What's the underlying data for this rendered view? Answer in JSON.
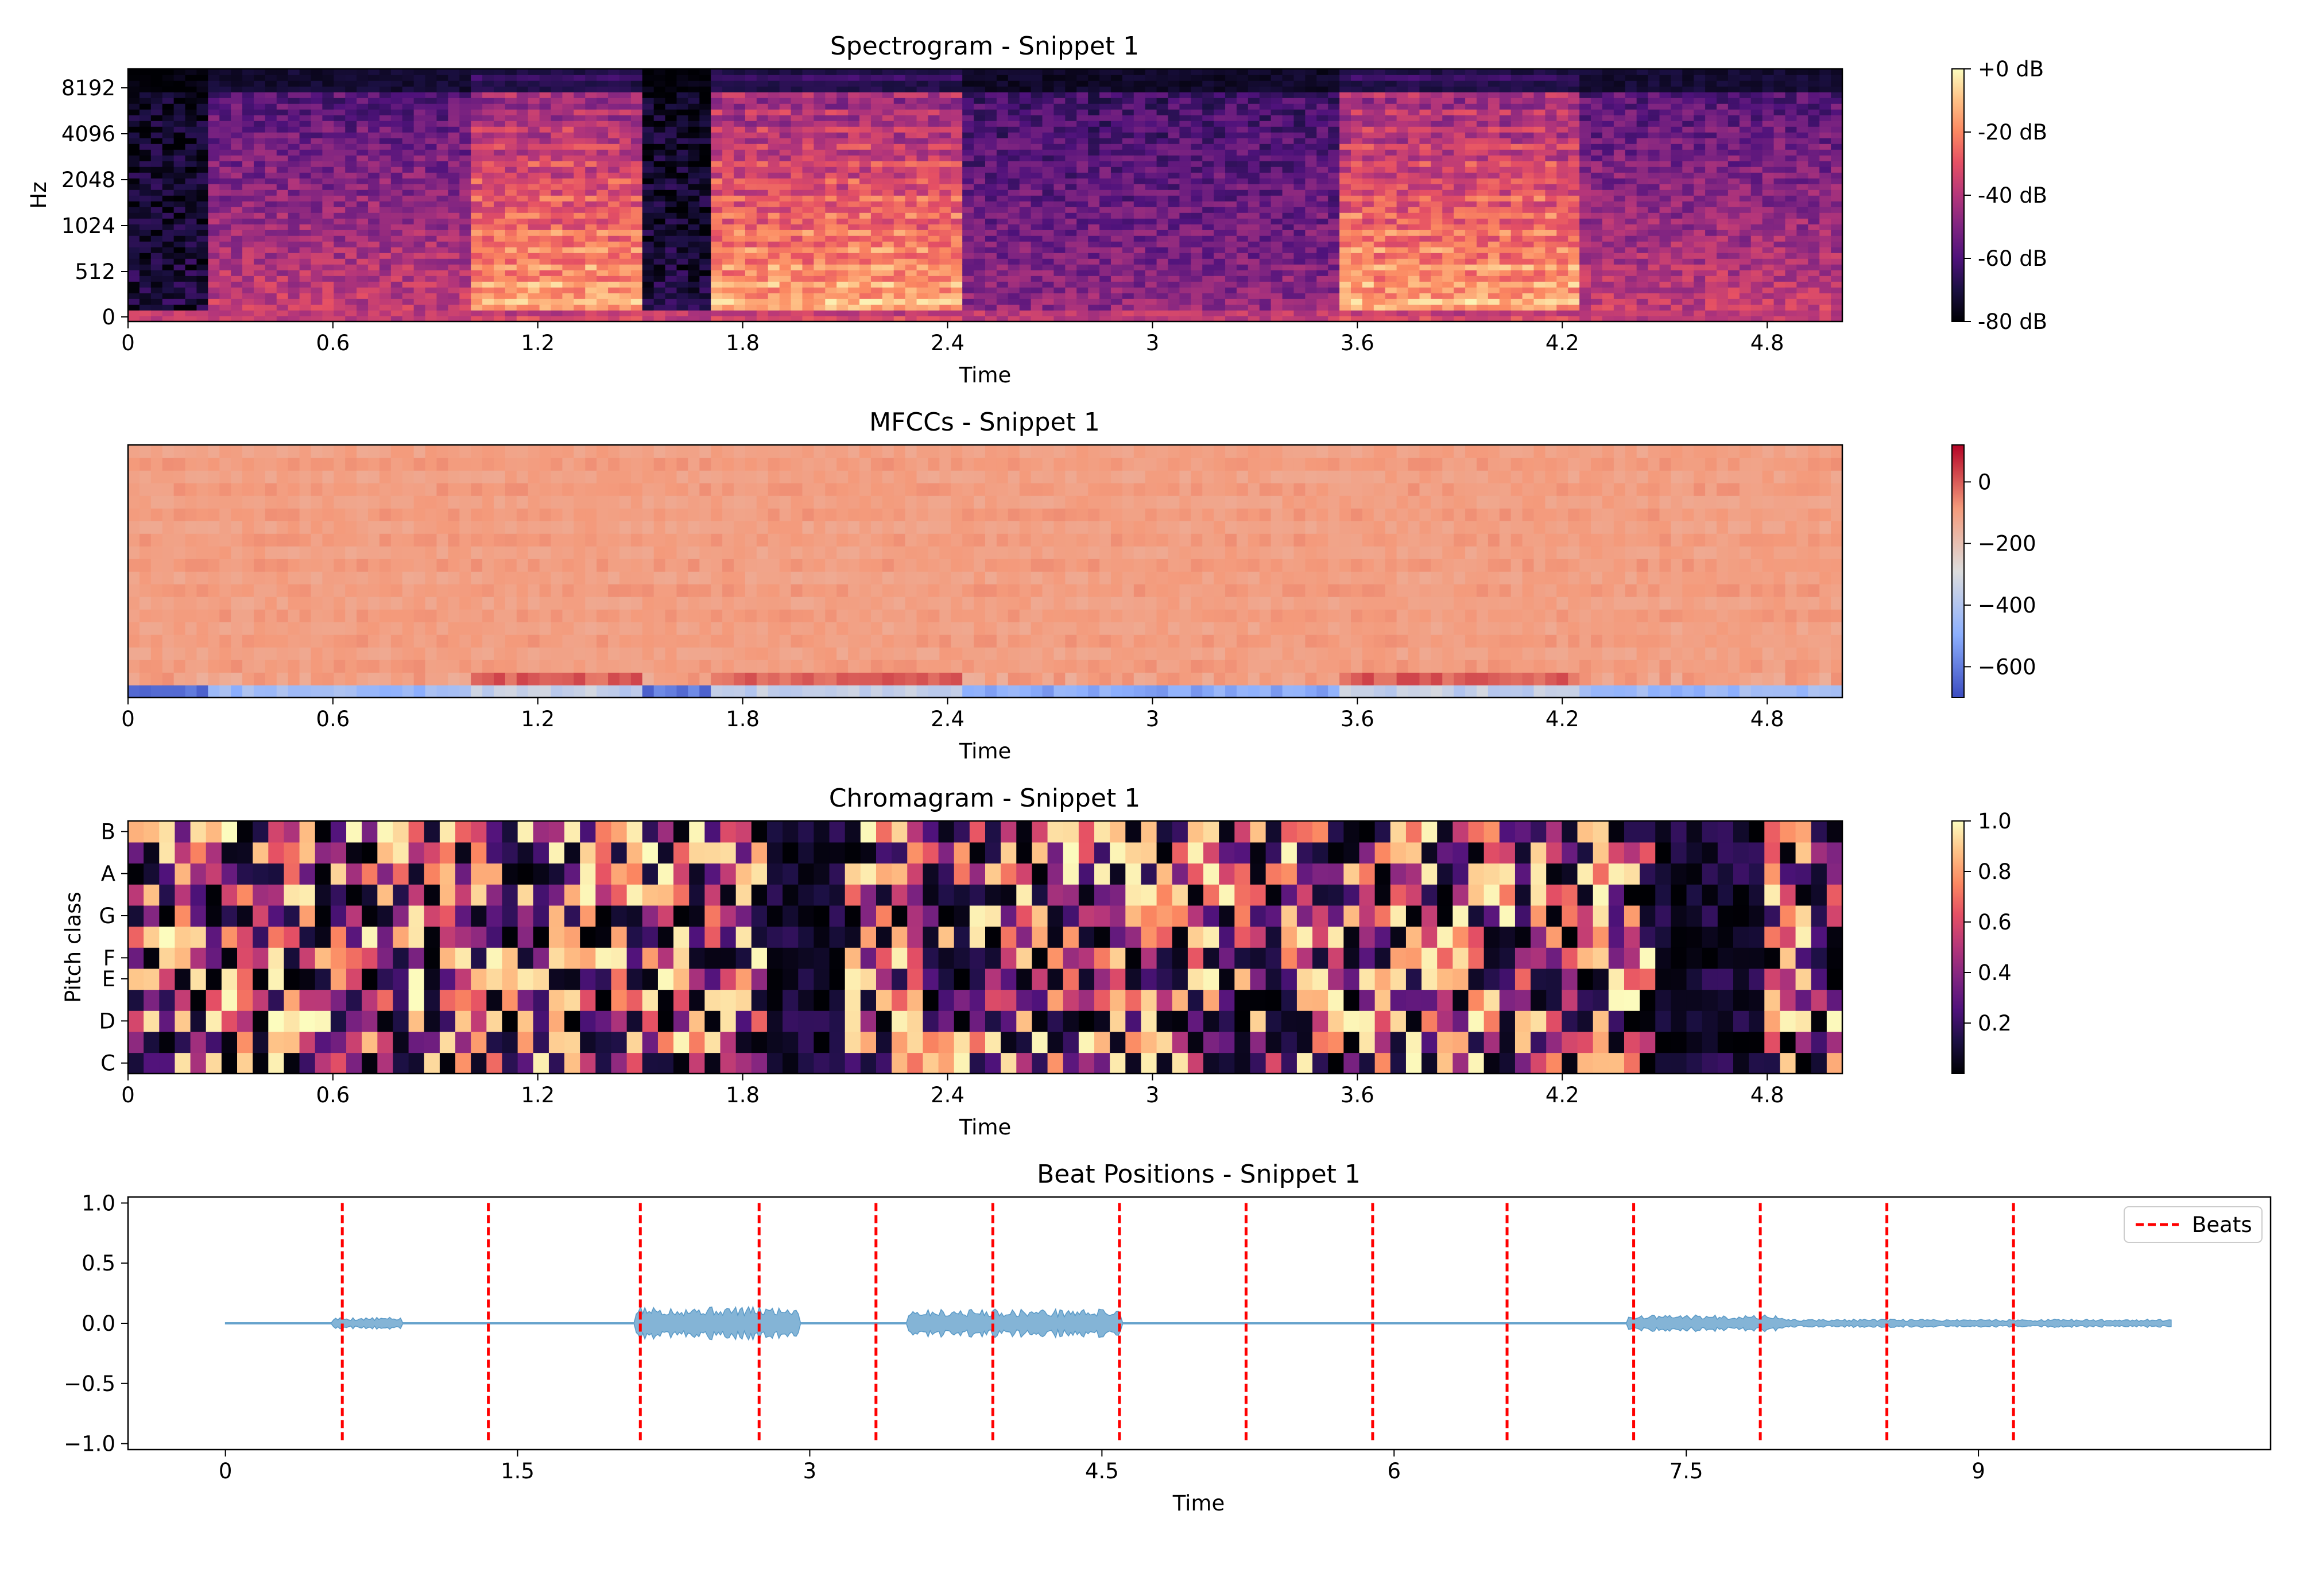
{
  "chart_data": [
    {
      "type": "heatmap",
      "title": "Spectrogram - Snippet 1",
      "xlabel": "Time",
      "ylabel": "Hz",
      "xlim": [
        0,
        5.02
      ],
      "xticks": [
        "0",
        "0.6",
        "1.2",
        "1.8",
        "2.4",
        "3",
        "3.6",
        "4.2",
        "4.8"
      ],
      "yticks": [
        "0",
        "512",
        "1024",
        "2048",
        "4096",
        "8192"
      ],
      "yscale": "log-frequency",
      "colormap": "magma",
      "colorbar": {
        "ticks": [
          "+0 dB",
          "-20 dB",
          "-40 dB",
          "-60 dB",
          "-80 dB"
        ],
        "range": [
          -80,
          0
        ]
      },
      "energy_over_time": [
        {
          "start": 0.0,
          "end": 0.25,
          "level": "low"
        },
        {
          "start": 0.25,
          "end": 1.0,
          "level": "medium"
        },
        {
          "start": 1.0,
          "end": 1.5,
          "level": "high"
        },
        {
          "start": 1.5,
          "end": 1.7,
          "level": "low"
        },
        {
          "start": 1.7,
          "end": 2.45,
          "level": "high"
        },
        {
          "start": 2.45,
          "end": 3.55,
          "level": "medium-low"
        },
        {
          "start": 3.55,
          "end": 4.25,
          "level": "high"
        },
        {
          "start": 4.25,
          "end": 5.02,
          "level": "medium"
        }
      ]
    },
    {
      "type": "heatmap",
      "title": "MFCCs - Snippet 1",
      "xlabel": "Time",
      "xlim": [
        0,
        5.02
      ],
      "xticks": [
        "0",
        "0.6",
        "1.2",
        "1.8",
        "2.4",
        "3",
        "3.6",
        "4.2",
        "4.8"
      ],
      "colormap": "coolwarm",
      "coefficients": 20,
      "colorbar": {
        "ticks": [
          "0",
          "−200",
          "−400",
          "−600"
        ],
        "range": [
          -700,
          120
        ]
      }
    },
    {
      "type": "heatmap",
      "title": "Chromagram - Snippet 1",
      "xlabel": "Time",
      "ylabel": "Pitch class",
      "xlim": [
        0,
        5.02
      ],
      "xticks": [
        "0",
        "0.6",
        "1.2",
        "1.8",
        "2.4",
        "3",
        "3.6",
        "4.2",
        "4.8"
      ],
      "yticks": [
        "C",
        "D",
        "E",
        "F",
        "G",
        "A",
        "B"
      ],
      "pitch_classes": 12,
      "colormap": "magma",
      "colorbar": {
        "ticks": [
          "1.0",
          "0.8",
          "0.6",
          "0.4",
          "0.2"
        ],
        "range": [
          0,
          1
        ]
      }
    },
    {
      "type": "line",
      "title": "Beat Positions - Snippet 1",
      "xlabel": "Time",
      "xlim": [
        -0.5,
        10.5
      ],
      "ylim": [
        -1.05,
        1.05
      ],
      "xticks": [
        "0",
        "1.5",
        "3",
        "4.5",
        "6",
        "7.5",
        "9"
      ],
      "yticks": [
        "1.0",
        "0.5",
        "0.0",
        "−0.5",
        "−1.0"
      ],
      "series": [
        {
          "label": "waveform",
          "color": "#1f77b4",
          "x_range": [
            0,
            9.99
          ],
          "envelope": [
            {
              "start": 0.55,
              "end": 0.9,
              "amp": 0.05
            },
            {
              "start": 2.1,
              "end": 2.95,
              "amp": 0.14
            },
            {
              "start": 3.5,
              "end": 4.6,
              "amp": 0.12
            },
            {
              "start": 7.2,
              "end": 8.0,
              "amp": 0.07
            },
            {
              "start": 8.0,
              "end": 10.0,
              "amp": 0.035
            }
          ]
        }
      ],
      "beats": {
        "name": "Beats",
        "color": "#ff0000",
        "times": [
          0.6,
          1.35,
          2.13,
          2.74,
          3.34,
          3.94,
          4.59,
          5.24,
          5.89,
          6.58,
          7.23,
          7.88,
          8.53,
          9.18
        ]
      },
      "legend": "top-right"
    }
  ]
}
